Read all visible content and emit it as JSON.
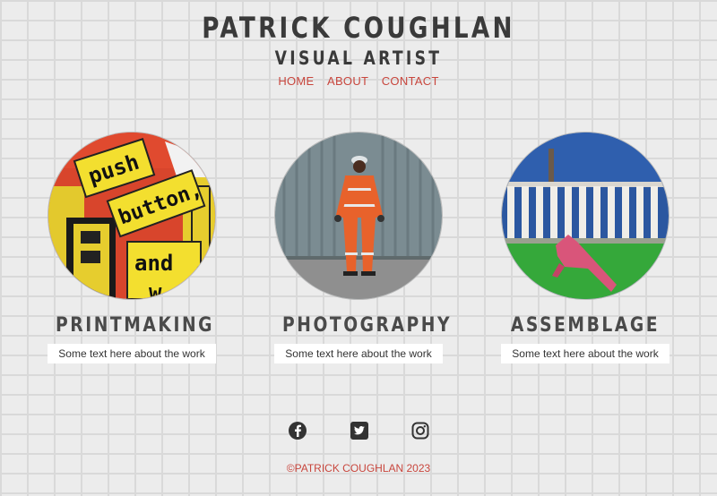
{
  "header": {
    "title": "PATRICK COUGHLAN",
    "subtitle": "VISUAL ARTIST",
    "nav": [
      "HOME",
      "ABOUT",
      "CONTACT"
    ]
  },
  "cards": [
    {
      "title": "PRINTMAKING",
      "text": "Some text here about the work",
      "sign_words": [
        "push",
        "button,",
        "and",
        "w"
      ]
    },
    {
      "title": "PHOTOGRAPHY",
      "text": "Some text here about the work"
    },
    {
      "title": "ASSEMBLAGE",
      "text": "Some text here about the work"
    }
  ],
  "footer": {
    "icons": [
      "facebook-icon",
      "twitter-icon",
      "instagram-icon"
    ],
    "copyright": "©PATRICK COUGHLAN 2023"
  },
  "colors": {
    "accent": "#c8463d",
    "heading": "#3a3a3a"
  }
}
